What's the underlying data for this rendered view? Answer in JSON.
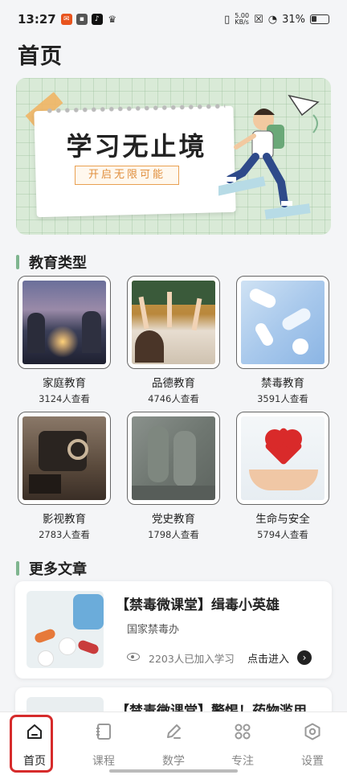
{
  "status": {
    "time": "13:27",
    "speed": "5.00",
    "speed_unit": "KB/s",
    "battery": "31%",
    "battery_level": 31
  },
  "page_title": "首页",
  "banner": {
    "title": "学习无止境",
    "subtitle": "开启无限可能"
  },
  "sections": {
    "education_types": "教育类型",
    "more_articles": "更多文章"
  },
  "categories": [
    {
      "name": "家庭教育",
      "views": "3124人查看",
      "icon": "family-photo"
    },
    {
      "name": "品德教育",
      "views": "4746人查看",
      "icon": "classroom-photo"
    },
    {
      "name": "禁毒教育",
      "views": "3591人查看",
      "icon": "pills-photo"
    },
    {
      "name": "影视教育",
      "views": "2783人查看",
      "icon": "film-projector-photo"
    },
    {
      "name": "党史教育",
      "views": "1798人查看",
      "icon": "relief-sculpture-photo"
    },
    {
      "name": "生命与安全",
      "views": "5794人查看",
      "icon": "heart-hands-photo"
    }
  ],
  "articles": [
    {
      "title": "【禁毒微课堂】缉毒小英雄",
      "source": "国家禁毒办",
      "count": "2203人已加入学习",
      "action": "点击进入"
    },
    {
      "title": "【禁毒微课堂】警惕！药物滥用"
    }
  ],
  "tabs": [
    {
      "label": "首页",
      "icon": "home-icon"
    },
    {
      "label": "课程",
      "icon": "notebook-icon"
    },
    {
      "label": "数学",
      "icon": "pen-icon"
    },
    {
      "label": "专注",
      "icon": "grid-icon"
    },
    {
      "label": "设置",
      "icon": "gear-icon"
    }
  ],
  "colors": {
    "accent": "#7fb58f",
    "highlight": "#d62b2b",
    "banner_bg": "#d9ead7",
    "subtitle_orange": "#e08f3e"
  }
}
